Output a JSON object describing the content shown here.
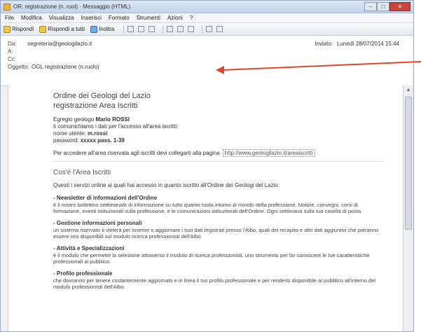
{
  "window": {
    "title": "OR: registrazione (n. ruol) · Messaggio (HTML)",
    "minimize": "–",
    "maximize": "□",
    "close": "✕"
  },
  "menu": [
    "File",
    "Modifica",
    "Visualizza",
    "Inserisci",
    "Formato",
    "Strumenti",
    "Azioni",
    "?"
  ],
  "toolbar": {
    "reply": "Rispondi",
    "reply_all": "Rispondi a tutti",
    "forward": "Inoltra"
  },
  "header": {
    "from_label": "Da:",
    "from_value": "segreteria@geologilazio.it",
    "to_label": "A:",
    "to_value": "",
    "cc_label": "Cc:",
    "cc_value": "",
    "subject_label": "Oggetto:",
    "subject_value": "OGL registrazione (n.ruolo)",
    "sent_label": "Inviato:",
    "sent_value": "Lunedì 28/07/2014 15:44"
  },
  "body": {
    "org_line1": "Ordine dei Geologi del Lazio",
    "org_line2": "registrazione Area Iscritti",
    "greet": "Egregio geologo",
    "greet_name": "Mario ROSSI",
    "intro": "ti comunichiamo i dati per l'accesso all'area iscritti:",
    "user_label": "nome utente:",
    "user_value": "m.rossi",
    "pass_label": "password:",
    "pass_value": "xxxxx pass. 1-39",
    "manual_text": "Per accedere all'area riservata agli iscritti devi collegarti alla pagina",
    "manual_link": "http://www.geologilazio.it/areaiscritti",
    "section_title": "Cos'è l'Area Iscritti",
    "section_intro": "Questi i servizi online ai quali hai accesso in quanto iscritto all'Ordine dei Geologi del Lazio:",
    "items": [
      {
        "title": "- Newsletter di informazioni dell'Ordine",
        "text": "è il nostro bollettino settimanale di informazione su tutto quanto ruota intorno al mondo della professione. Notizie, convegni, corsi di formazione, eventi istituzionali sulla professione, e le comunicazioni istituzionali dell'Ordine. Ogni settimana sulla tua casella di posta."
      },
      {
        "title": "- Gestione informazioni personali",
        "text": "un sistema riservato ti vieterà per inserire o aggiornare i tuoi dati registrati presso l'Albo, quali del recapito e altri dati aggiuntivi che potranno essere resi disponibili sul modulo ricerca professionisti dell'Albo."
      },
      {
        "title": "- Attività e Specializzazioni",
        "text": "è il modulo che permette la selezione attraverso il modulo di ricerca professionisti, uno strumento per far conoscere le tue caratteristiche professionali al pubblico."
      },
      {
        "title": "- Profilo professionale",
        "text": "che dovranno per tenere costantemente aggiornato e in linea il tuo profilo professionale e per renderlo disponibile al pubblico all'interno del modulo professionisti dell'Albo."
      }
    ]
  },
  "annotation_color": "#e0452b"
}
